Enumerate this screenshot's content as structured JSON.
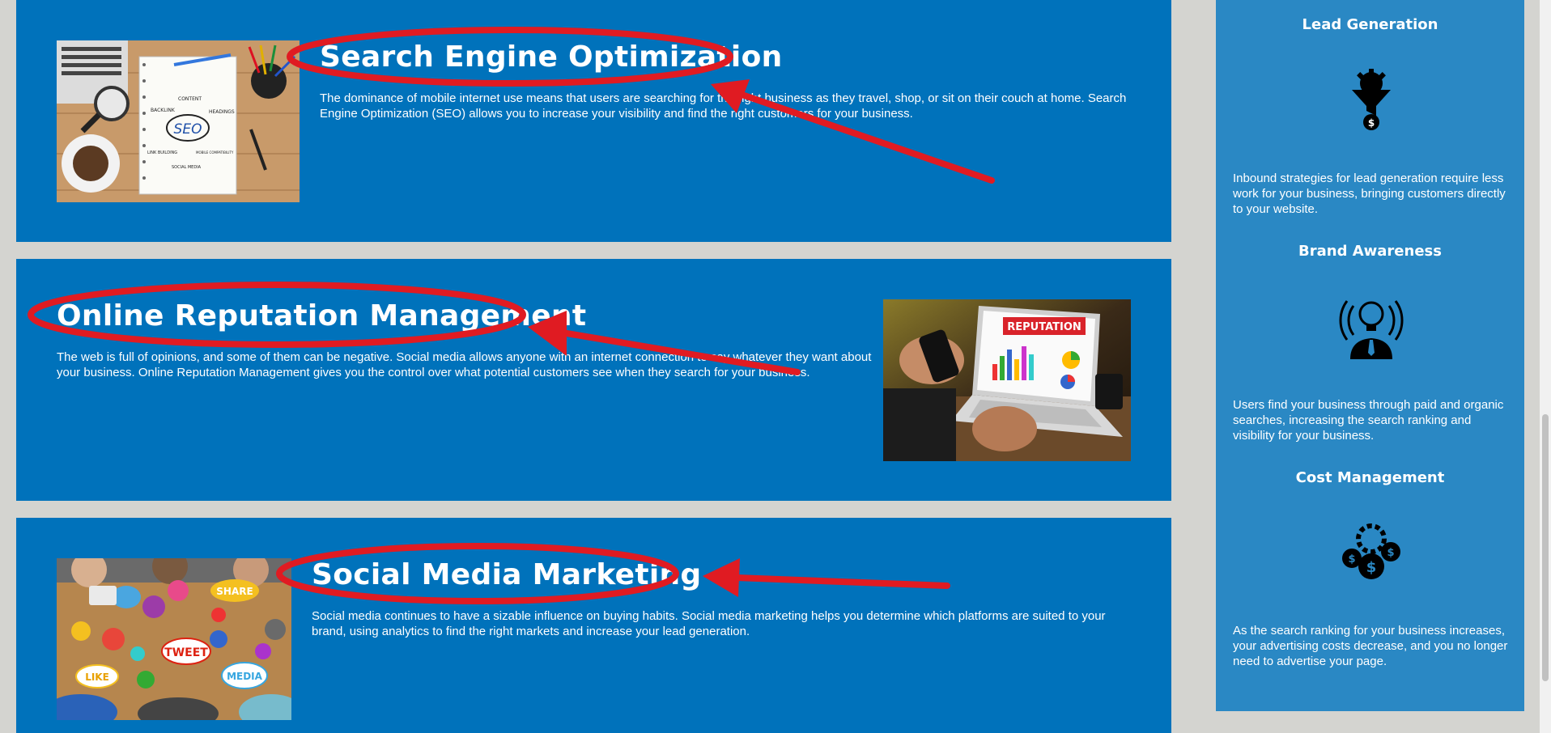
{
  "services": [
    {
      "title": "Search Engine Optimization",
      "text": "The dominance of mobile internet use means that users are searching for the right business as they travel, shop, or sit on their couch at home. Search Engine Optimization (SEO) allows you to increase your visibility and find the right customers for your business.",
      "image_labels": [
        "SEO",
        "CONTENT",
        "BACKLINK",
        "HEADINGS",
        "LINK BUILDING",
        "MOBILE COMPATIBILITY",
        "SOCIAL MEDIA"
      ]
    },
    {
      "title": "Online Reputation Management",
      "text": "The web is full of opinions, and some of them can be negative. Social media allows anyone with an internet connection to say whatever they want about your business. Online Reputation Management gives you the control over what potential customers see when they search for your business.",
      "image_labels": [
        "REPUTATION"
      ]
    },
    {
      "title": "Social Media Marketing",
      "text": "Social media continues to have a sizable influence on buying habits. Social media marketing helps you determine which platforms are suited to your brand, using analytics to find the right markets and increase your lead generation.",
      "image_labels": [
        "SHARE",
        "TWEET",
        "LIKE",
        "MEDIA"
      ]
    }
  ],
  "sidebar": [
    {
      "title": "Lead Generation",
      "icon": "lead-funnel-icon",
      "text": "Inbound strategies for lead generation require less work for your business, bringing customers directly to your website."
    },
    {
      "title": "Brand Awareness",
      "icon": "lightbulb-broadcast-icon",
      "text": "Users find your business through paid and organic searches, increasing the search ranking and visibility for your business."
    },
    {
      "title": "Cost Management",
      "icon": "gear-coins-icon",
      "text": "As the search ranking for your business increases, your advertising costs decrease, and you no longer need to advertise your page."
    }
  ],
  "colors": {
    "page_background": "#d4d4d0",
    "section_blue": "#0072bb",
    "sidebar_blue": "#2a88c4",
    "annotation_red": "#e01b22"
  }
}
